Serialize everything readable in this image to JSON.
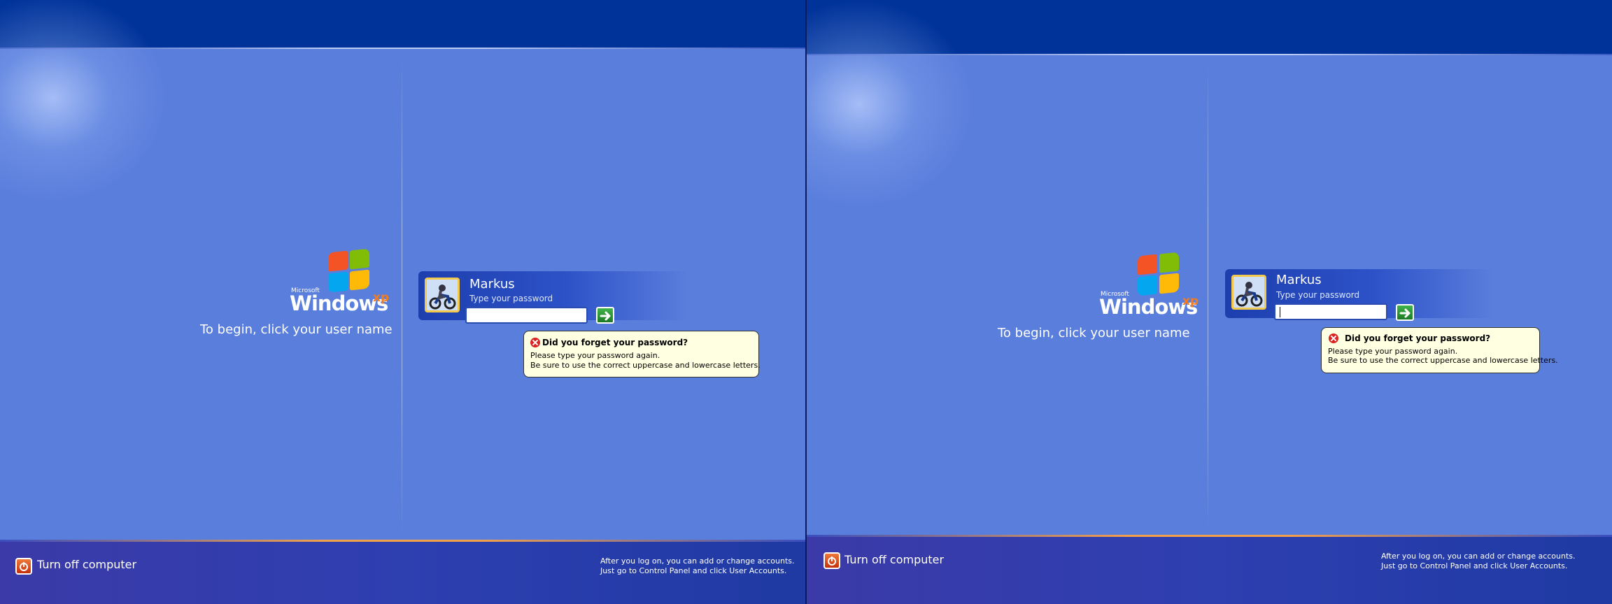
{
  "screens": [
    {
      "logo": {
        "microsoft": "Microsoft",
        "windows": "Windows",
        "xp": "xp"
      },
      "begin_text": "To begin, click your user name",
      "user": {
        "name": "Markus",
        "prompt": "Type your password",
        "password_value": ""
      },
      "balloon": {
        "title": "Did you forget your password?",
        "line1": "Please type your password again.",
        "line2": "Be sure to use the correct uppercase and lowercase letters."
      },
      "footer": {
        "turn_off": "Turn off computer",
        "info_line1": "After you log on, you can add or change accounts.",
        "info_line2": "Just go to Control Panel and click User Accounts."
      }
    },
    {
      "logo": {
        "microsoft": "Microsoft",
        "windows": "Windows",
        "xp": "xp"
      },
      "begin_text": "To begin, click your user name",
      "user": {
        "name": "Markus",
        "prompt": "Type your password",
        "password_value": ""
      },
      "balloon": {
        "title": "Did you forget your password?",
        "line1": "Please type your password again.",
        "line2": "Be sure to use the correct uppercase and lowercase letters."
      },
      "footer": {
        "turn_off": "Turn off computer",
        "info_line1": "After you log on, you can add or change accounts.",
        "info_line2": "Just go to Control Panel and click User Accounts."
      }
    }
  ],
  "colors": {
    "top_bar": "#003399",
    "background": "#5a7edc",
    "flag_red": "#f35325",
    "flag_green": "#81bc06",
    "flag_blue": "#05a6f0",
    "flag_yellow": "#ffba08",
    "xp_orange": "#f47c20",
    "balloon_bg": "#ffffe1"
  },
  "icons": [
    "windows-flag-icon",
    "user-avatar-icon",
    "go-arrow-icon",
    "error-icon",
    "power-icon"
  ]
}
